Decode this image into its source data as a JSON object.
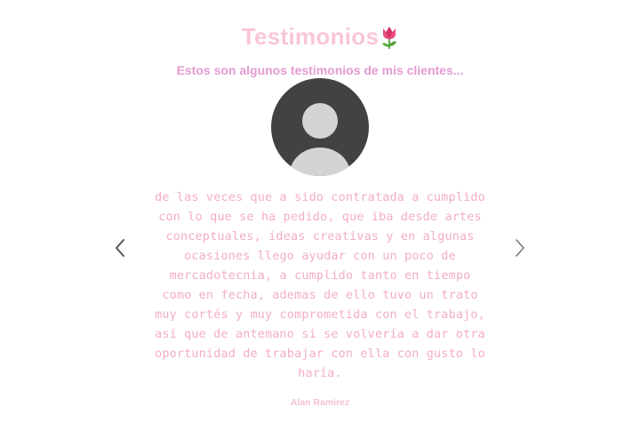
{
  "section": {
    "title": "Testimonios",
    "subtitle": "Estos son algunos testimonios de mis clientes..."
  },
  "testimonial": {
    "text": "de las veces que a sido contratada a cumplido con lo que se ha pedido, que iba desde artes conceptuales, ideas creativas y en algunas ocasiones llego ayudar con un poco de mercadotecnia, a cumplido tanto en tiempo como en fecha, ademas de ello tuvo un trato muy cortés y muy comprometida con el trabajo, así que de antemano si se volvería a dar otra oportunidad de trabajar con ella con gusto lo haría.",
    "author": "Alan Ramirez"
  },
  "icons": {
    "title_icon": "tulip-icon",
    "avatar": "default-user-avatar",
    "prev": "chevron-left-icon",
    "next": "chevron-right-icon"
  },
  "colors": {
    "title": "#f9c6d6",
    "subtitle": "#e59ad3",
    "quote_text": "#f3adc6",
    "avatar_bg": "#424244",
    "avatar_figure": "#d4d4d6",
    "arrow": "#555555"
  }
}
